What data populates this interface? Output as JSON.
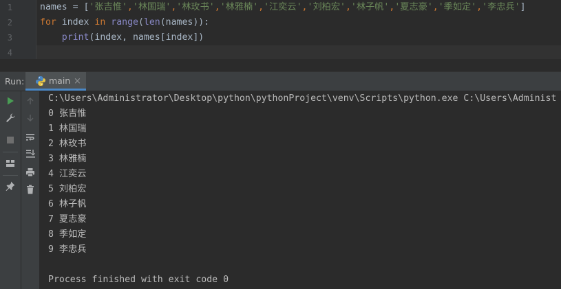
{
  "editor": {
    "line_numbers": [
      "1",
      "2",
      "3",
      "4"
    ],
    "line1": {
      "var": "names",
      "assign": " = [",
      "strings": [
        "'张吉惟'",
        "'林国瑞'",
        "'林玫书'",
        "'林雅楠'",
        "'江奕云'",
        "'刘柏宏'",
        "'林子帆'",
        "'夏志豪'",
        "'季如定'",
        "'李忠兵'"
      ],
      "close": "]"
    },
    "line2": {
      "kw_for": "for",
      "var": " index ",
      "kw_in": "in",
      "range_fn": "range",
      "paren_open": "(",
      "len_fn": "len",
      "args": "(names)):"
    },
    "line3": {
      "print_fn": "print",
      "args": "(index, names[index])"
    }
  },
  "run_panel": {
    "label": "Run:",
    "tab_label": "main",
    "tab_close": "×"
  },
  "console": {
    "command": "C:\\Users\\Administrator\\Desktop\\python\\pythonProject\\venv\\Scripts\\python.exe C:\\Users\\Administ",
    "output_lines": [
      "0 张吉惟",
      "1 林国瑞",
      "2 林玫书",
      "3 林雅楠",
      "4 江奕云",
      "5 刘柏宏",
      "6 林子帆",
      "7 夏志豪",
      "8 季如定",
      "9 李忠兵"
    ],
    "exit_message": "Process finished with exit code 0"
  },
  "colors": {
    "keyword": "#cc7832",
    "builtin": "#8888c6",
    "string": "#6a8759",
    "run_green": "#499c54"
  },
  "icons": {
    "toolbar_left": [
      "run-icon",
      "wrench-icon",
      "stop-icon",
      "layout-icon",
      "pin-icon"
    ],
    "toolbar_right": [
      "up-arrow-icon",
      "down-arrow-icon",
      "soft-wrap-icon",
      "scroll-to-end-icon",
      "print-icon",
      "trash-icon"
    ]
  }
}
